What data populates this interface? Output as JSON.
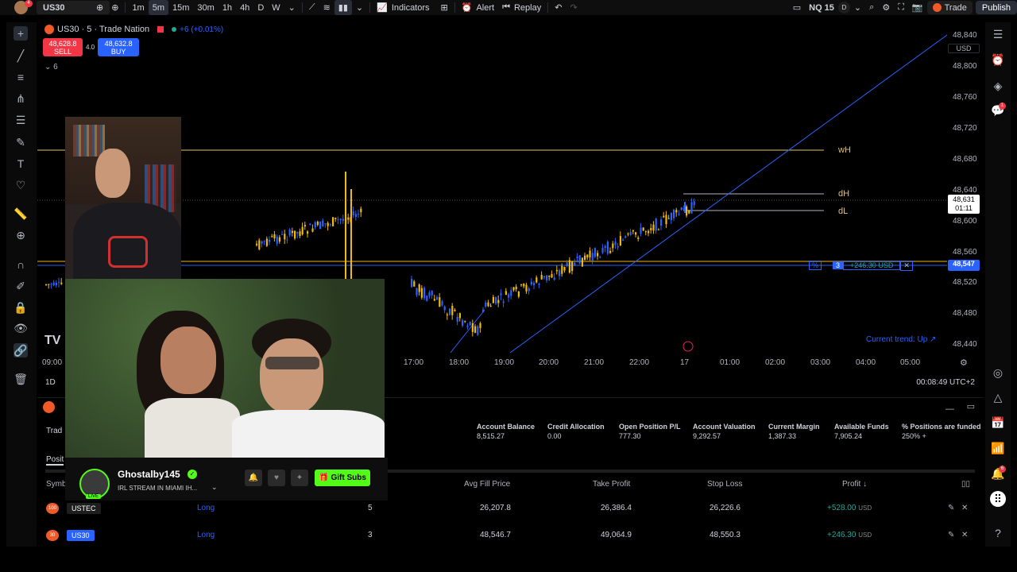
{
  "topbar": {
    "symbol": "US30",
    "avatar_badge": "4",
    "timeframes": [
      "1m",
      "5m",
      "15m",
      "30m",
      "1h",
      "4h",
      "D",
      "W"
    ],
    "active_timeframe": "5m",
    "indicators_label": "Indicators",
    "alert_label": "Alert",
    "replay_label": "Replay",
    "layout_name": "NQ 15",
    "layout_badge": "D",
    "trade_label": "Trade",
    "publish_label": "Publish"
  },
  "legend": {
    "title": "US30 · 5 · Trade Nation",
    "change": "+6 (+0.01%)",
    "sell_price": "48,628.8",
    "sell_label": "SELL",
    "spread": "4.0",
    "buy_price": "48,632.8",
    "buy_label": "BUY",
    "indicator_count": "6",
    "currency": "USD"
  },
  "price_axis": [
    "48,840",
    "48,800",
    "48,760",
    "48,720",
    "48,680",
    "48,640",
    "48,600",
    "48,560",
    "48,520",
    "48,480",
    "48,440"
  ],
  "price_tags": {
    "current_price": "48,631",
    "countdown": "01:11",
    "position_price": "48,547"
  },
  "time_axis": [
    "09:00",
    "17:00",
    "18:00",
    "19:00",
    "20:00",
    "21:00",
    "22:00",
    "17",
    "01:00",
    "02:00",
    "03:00",
    "04:00",
    "05:00"
  ],
  "levels": {
    "wh": "wH",
    "dh": "dH",
    "dl": "dL"
  },
  "position_tag": {
    "qty": "3",
    "pl": "+246.30 USD"
  },
  "trend_label": "Current trend: Up ↗",
  "status": {
    "range": "1D",
    "clock": "00:08:49 UTC+2"
  },
  "account": [
    {
      "label": "Account Balance",
      "value": "8,515.27"
    },
    {
      "label": "Credit Allocation",
      "value": "0.00"
    },
    {
      "label": "Open Position P/L",
      "value": "777.30"
    },
    {
      "label": "Account Valuation",
      "value": "9,292.57"
    },
    {
      "label": "Current Margin",
      "value": "1,387.33"
    },
    {
      "label": "Available Funds",
      "value": "7,905.24"
    },
    {
      "label": "% Positions are funded",
      "value": "250% +"
    }
  ],
  "panel_tabs": {
    "trade": "Trad",
    "positions": "Posit",
    "symbol_col": "Symb"
  },
  "columns": [
    "Avg Fill Price",
    "Take Profit",
    "Stop Loss",
    "Profit ↓"
  ],
  "rows": [
    {
      "symbol": "USTEC",
      "side": "Long",
      "qty": "5",
      "avg": "26,207.8",
      "tp": "26,386.4",
      "sl": "26,226.6",
      "profit": "+528.00",
      "ccy": "USD",
      "badge": "100"
    },
    {
      "symbol": "US30",
      "side": "Long",
      "qty": "3",
      "avg": "48,546.7",
      "tp": "49,064.9",
      "sl": "48,550.3",
      "profit": "+246.30",
      "ccy": "USD",
      "badge": "30"
    }
  ],
  "streamer": {
    "name": "Ghostalby145",
    "subtitle": "IRL STREAM IN MIAMI IH...",
    "gift_label": "Gift Subs",
    "live_label": "LIVE"
  },
  "colors": {
    "up": "#2962ff",
    "down": "#f0b90b",
    "accent": "#2962ff",
    "sell": "#f23645",
    "kick_green": "#53fc18",
    "level": "#e0c080"
  }
}
